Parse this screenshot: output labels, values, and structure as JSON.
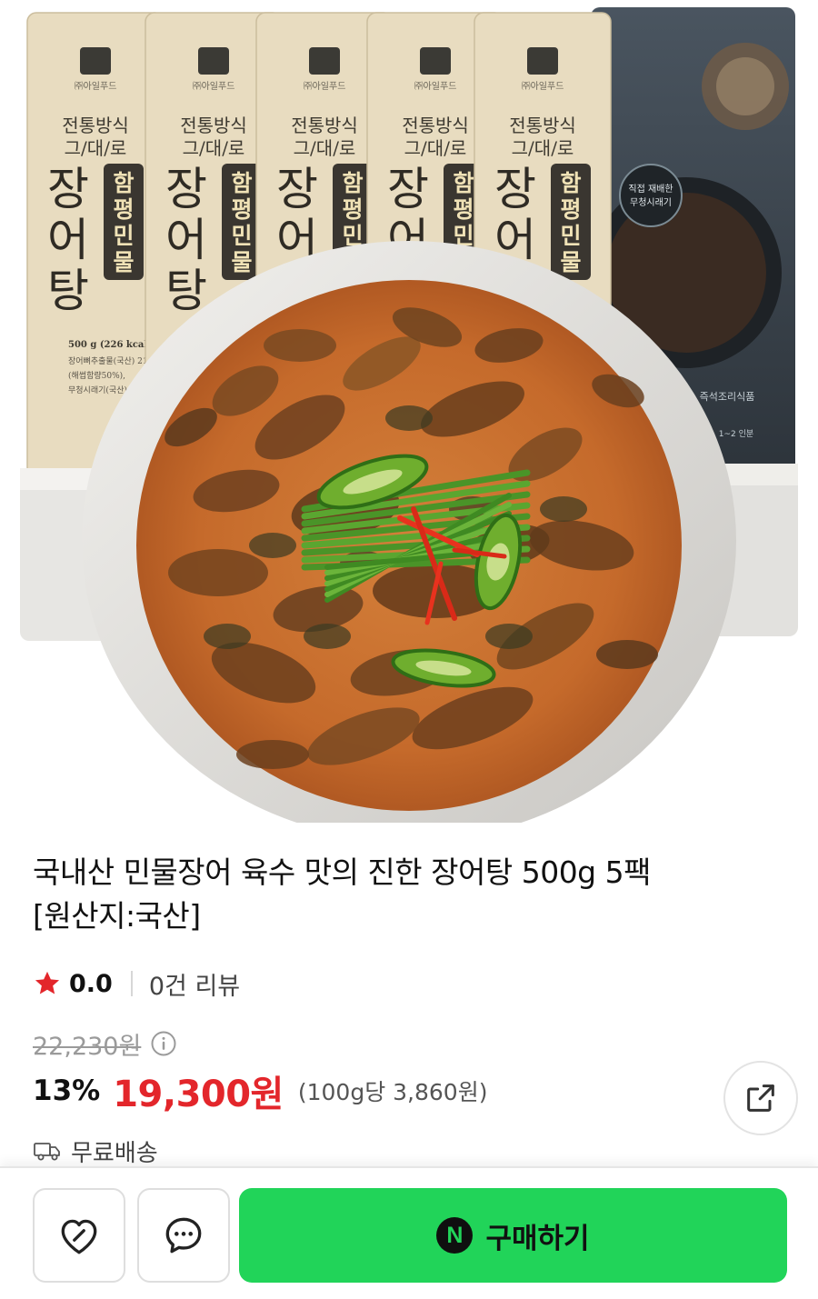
{
  "product_image": {
    "brand": "㈜아일푸드",
    "tagline_1": "전통방식",
    "tagline_2": "그/대/로",
    "name_main": "장어탕",
    "name_side": "함평민물",
    "spec_weight": "500 g (226 kcal)",
    "spec_ingredient_1": "장어뼈추출물(국산) 21",
    "spec_ingredient_2": "(해썹함량50%),",
    "spec_ingredient_3": "무청시래기(국산) 18",
    "dark_pack_badge_1": "직접 재배한",
    "dark_pack_badge_2": "무청시래기",
    "dark_pack_type": "즉석조리식품",
    "dark_pack_serving": "1~2 인분"
  },
  "product": {
    "title_line1": "국내산 민물장어 육수 맛의 진한 장어탕 500g 5팩",
    "title_line2": "[원산지:국산]"
  },
  "rating": {
    "score": "0.0",
    "reviews": "0건 리뷰",
    "star_color": "#e3262b"
  },
  "price": {
    "original": "22,230원",
    "discount": "13%",
    "sale": "19,300원",
    "unit": "(100g당 3,860원)",
    "sale_color": "#e3262b"
  },
  "shipping": {
    "label": "무료배송"
  },
  "actions": {
    "buy_label": "구매하기",
    "buy_logo": "N",
    "buy_color": "#21d459",
    "wish_icon": "heart-icon",
    "talk_icon": "chat-bubble-icon",
    "share_icon": "share-icon"
  }
}
